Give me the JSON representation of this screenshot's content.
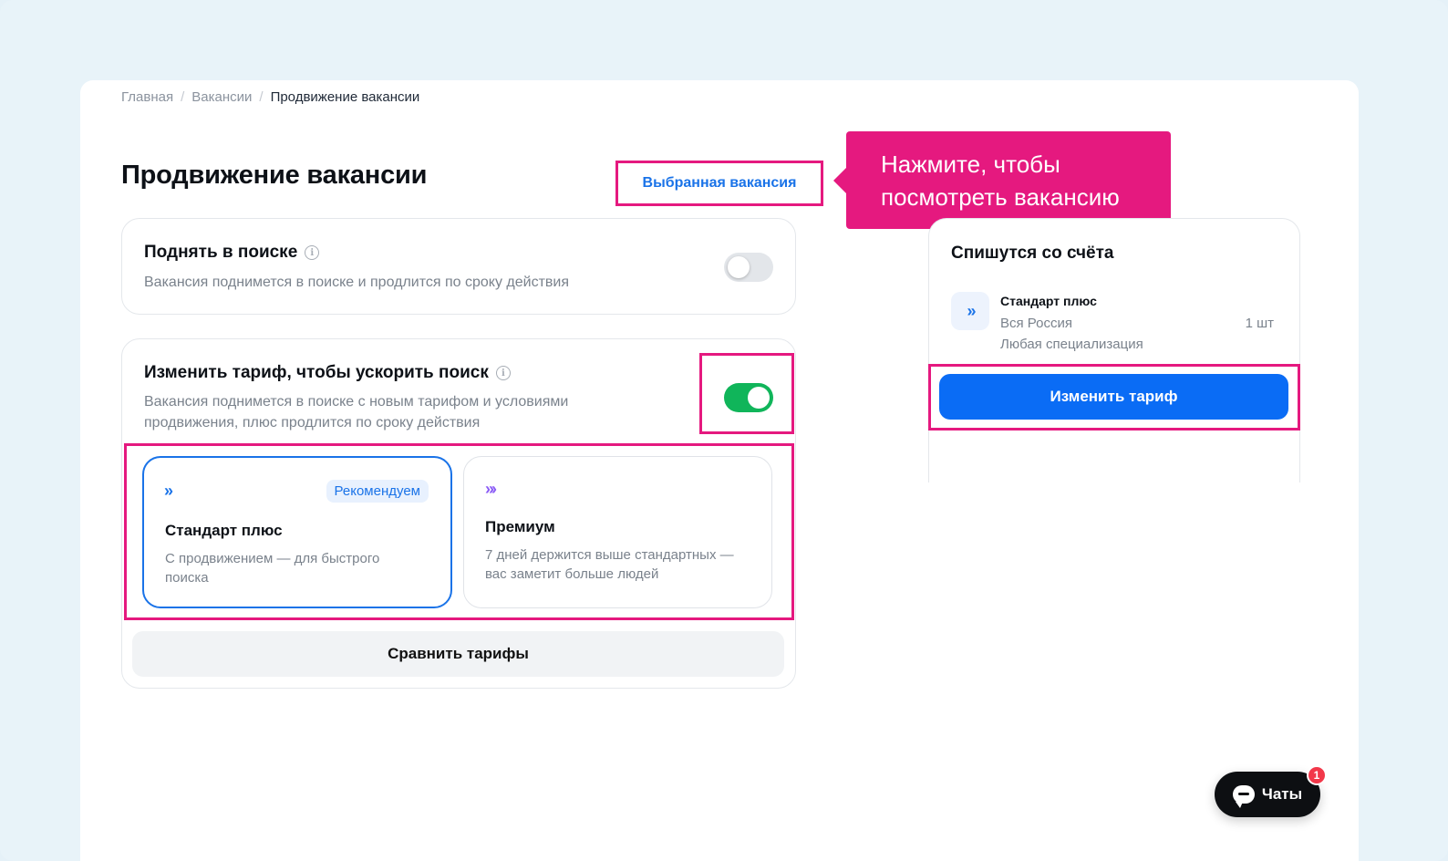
{
  "breadcrumb": {
    "home": "Главная",
    "vacancies": "Вакансии",
    "current": "Продвижение вакансии",
    "separator": "/"
  },
  "page": {
    "title": "Продвижение вакансии"
  },
  "selected_vacancy": {
    "label": "Выбранная вакансия"
  },
  "tooltip": {
    "text": "Нажмите, чтобы посмотреть вакансию"
  },
  "raise": {
    "title": "Поднять в поиске",
    "description": "Вакансия поднимется в поиске и продлится по сроку действия",
    "enabled": false
  },
  "tariff": {
    "title": "Изменить тариф, чтобы ускорить поиск",
    "description_line1": "Вакансия поднимется в поиске с новым тарифом и условиями",
    "description_line2": "продвижения, плюс продлится по сроку действия",
    "enabled": true,
    "options": [
      {
        "name": "Стандарт плюс",
        "icon": "double-chevron-right-icon",
        "badge": "Рекомендуем",
        "desc_line1": "С продвижением — для быстрого",
        "desc_line2": "поиска",
        "selected": true
      },
      {
        "name": "Премиум",
        "icon": "triple-chevron-right-icon",
        "desc_line1": "7 дней держится выше стандартных —",
        "desc_line2": "вас заметит больше людей",
        "selected": false
      }
    ],
    "compare_label": "Сравнить тарифы"
  },
  "summary": {
    "title": "Спишутся со счёта",
    "item_name": "Стандарт плюс",
    "region": "Вся Россия",
    "specialization": "Любая специализация",
    "quantity": "1 шт",
    "change_label": "Изменить тариф"
  },
  "chats": {
    "label": "Чаты",
    "unread": "1"
  },
  "colors": {
    "accent": "#1a73e8",
    "highlight": "#e5197f",
    "toggle_on": "#10b55a",
    "primary_button": "#0a6cf5",
    "premium_icon": "#8b5cf6"
  }
}
